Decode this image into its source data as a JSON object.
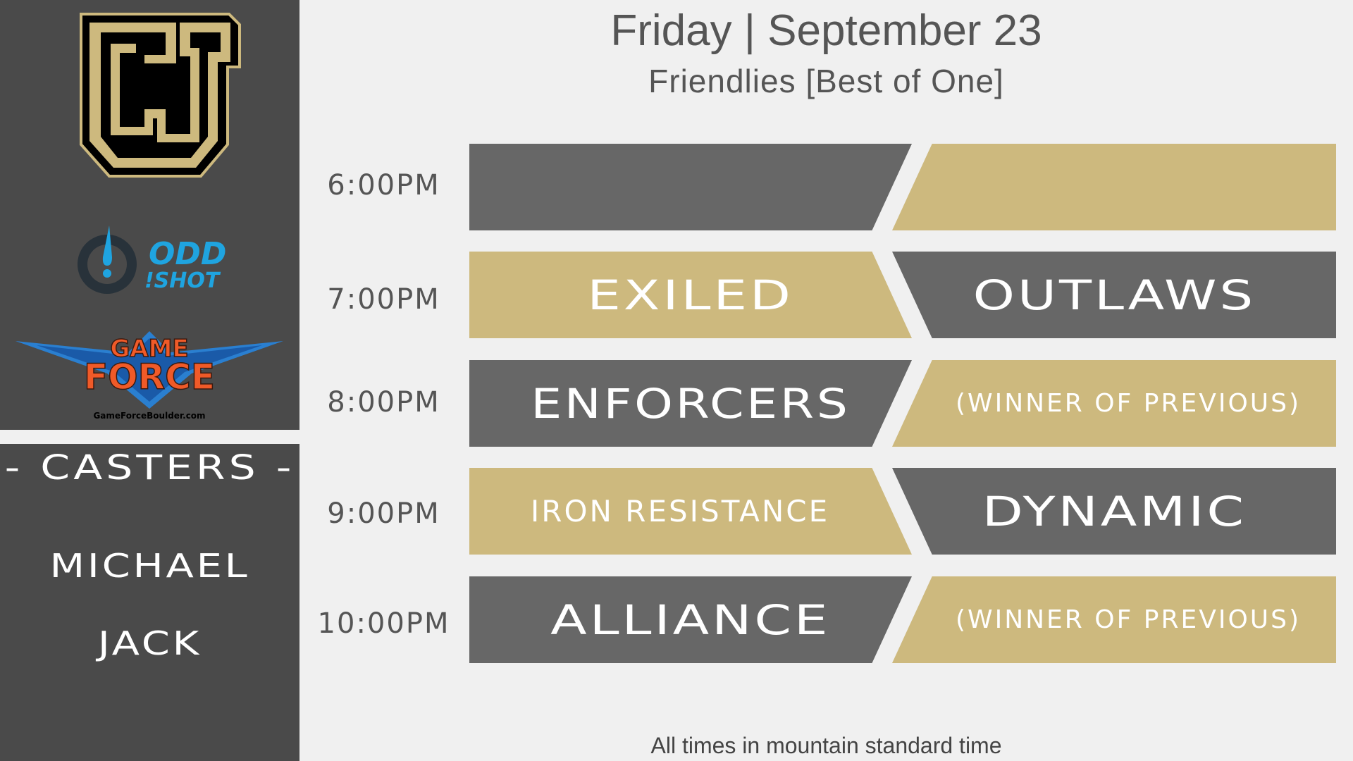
{
  "header": {
    "title": "Friday | September 23",
    "subtitle": "Friendlies [Best of One]"
  },
  "sidebar": {
    "sponsors": {
      "gameforce_line1": "GAME",
      "gameforce_line2": "FORCE",
      "gameforce_url": "GameForceBoulder.com",
      "oddshot_line1": "ODD",
      "oddshot_line2": "!SHOT"
    },
    "casters_title": "- CASTERS -",
    "casters": [
      "MICHAEL",
      "JACK"
    ]
  },
  "schedule": [
    {
      "time": "6:00PM",
      "team_left": "",
      "team_right": ""
    },
    {
      "time": "7:00PM",
      "team_left": "EXILED",
      "team_right": "OUTLAWS"
    },
    {
      "time": "8:00PM",
      "team_left": "ENFORCERS",
      "team_right": "(WINNER OF PREVIOUS)"
    },
    {
      "time": "9:00PM",
      "team_left": "IRON RESISTANCE",
      "team_right": "DYNAMIC"
    },
    {
      "time": "10:00PM",
      "team_left": "ALLIANCE",
      "team_right": "(WINNER OF PREVIOUS)"
    }
  ],
  "footer": "All times in mountain standard time",
  "colors": {
    "sidebar": "#4a4a4a",
    "gray_slot": "#676767",
    "gold_slot": "#cdb97e",
    "background": "#f0f0f0"
  }
}
